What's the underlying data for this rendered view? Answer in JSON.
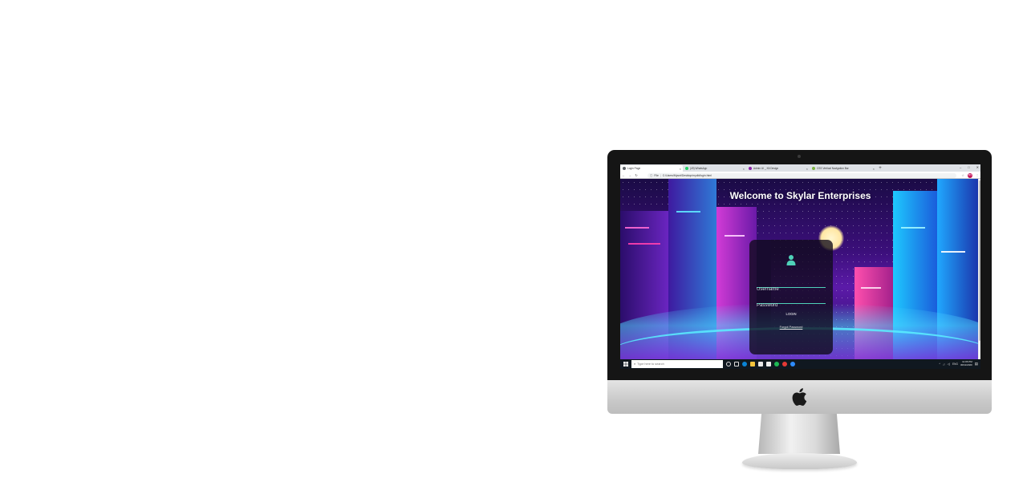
{
  "browser": {
    "tabs": [
      {
        "label": "Login Page",
        "active": true,
        "favicon_color": "#5f6368"
      },
      {
        "label": "(49) WhatsApp",
        "active": false,
        "favicon_color": "#25d366"
      },
      {
        "label": "Admin UI _ Kit Design",
        "active": false,
        "favicon_color": "#8e24aa"
      },
      {
        "label": "CSS Vertical Navigation Bar",
        "active": false,
        "favicon_color": "#7cb342"
      }
    ],
    "new_tab": "+",
    "window_controls": {
      "minimize": "–",
      "maximize": "□",
      "close": "✕"
    },
    "address": {
      "scheme": "File",
      "path": "C:/Users/Mysnt/Desktop/mydb/login.html"
    },
    "profile_initials": "MS"
  },
  "page": {
    "title": "Welcome to Skylar Enterprises",
    "username_placeholder": "Username",
    "password_placeholder": "Password",
    "login_label": "LOGIN",
    "forgot_label": "Forgot Password"
  },
  "taskbar": {
    "search_placeholder": "Type here to search",
    "language": "ENG",
    "time": "11:06 PM",
    "date": "30/11/2020"
  },
  "colors": {
    "accent": "#4fd1b8",
    "card_bg": "#0f0a19",
    "taskbar_bg": "#101820"
  }
}
